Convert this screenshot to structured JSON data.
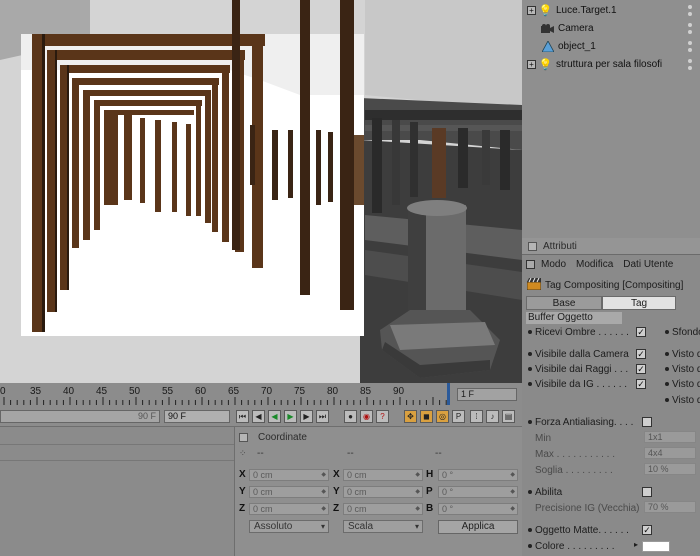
{
  "object_manager": {
    "items": [
      {
        "label": "Luce.Target.1",
        "icon": "light-icon",
        "expandable": true
      },
      {
        "label": "Camera",
        "icon": "camera-icon",
        "expandable": false
      },
      {
        "label": "object_1",
        "icon": "triangle-object-icon",
        "expandable": false
      },
      {
        "label": "struttura per sala filosofi",
        "icon": "null-object-icon",
        "expandable": true
      }
    ]
  },
  "attributes": {
    "header": "Attributi",
    "menu": [
      "Modo",
      "Modifica",
      "Dati Utente"
    ],
    "title": "Tag Compositing [Compositing]",
    "tabs": [
      "Base",
      "Tag"
    ],
    "section": "Buffer Oggetto",
    "props": {
      "ricevi_ombre": "Ricevi Ombre . . . . . .",
      "sfondo": "Sfondo",
      "visibile_camera": "Visibile dalla Camera",
      "visto1": "Visto d",
      "visibile_raggi": "Visibile dai Raggi . . .",
      "visto2": "Visto d",
      "visibile_ig": "Visibile da IG . . . . . .",
      "visto3": "Visto d",
      "visto4": "Visto d",
      "forza_aa": "Forza Antialiasing. . . .",
      "min": "Min",
      "min_value": "1x1",
      "max": "Max . . . . . . . . . . .",
      "max_value": "4x4",
      "soglia": "Soglia . . . . . . . . .",
      "soglia_value": "10 %",
      "abilita": "Abilita",
      "precisione": "Precisione IG (Vecchia)",
      "precisione_value": "70 %",
      "oggetto_matte": "Oggetto Matte. . . . . .",
      "colore": "Colore . . . . . . . . ."
    },
    "color_value": "#ffffff"
  },
  "timeline": {
    "ticks": [
      "0",
      "35",
      "40",
      "45",
      "50",
      "55",
      "60",
      "65",
      "70",
      "75",
      "80",
      "85",
      "90"
    ],
    "current_frame": "1 F",
    "end_frame_a": "90 F",
    "end_frame_b": "90 F"
  },
  "coordinates": {
    "header": "Coordinate",
    "col_headers": [
      "--",
      "--",
      "--"
    ],
    "rows": [
      {
        "l1": "X",
        "v1": "0 cm",
        "l2": "X",
        "v2": "0 cm",
        "l3": "H",
        "v3": "0 °"
      },
      {
        "l1": "Y",
        "v1": "0 cm",
        "l2": "Y",
        "v2": "0 cm",
        "l3": "P",
        "v3": "0 °"
      },
      {
        "l1": "Z",
        "v1": "0 cm",
        "l2": "Z",
        "v2": "0 cm",
        "l3": "B",
        "v3": "0 °"
      }
    ],
    "mode_dropdown": "Assoluto",
    "scale_dropdown": "Scala",
    "apply_button": "Applica"
  }
}
